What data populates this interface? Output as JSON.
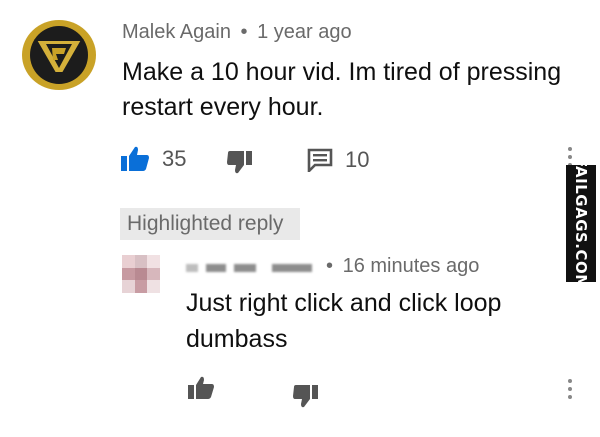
{
  "colors": {
    "accent_blue": "#0a6fd8",
    "meta_gray": "#6a6a6a",
    "icon_gray": "#555555",
    "avatar_gold": "#c9a227"
  },
  "comment": {
    "author": "Malek Again",
    "separator": "•",
    "time": "1 year ago",
    "text": "Make a 10 hour vid. Im tired of pressing restart every hour.",
    "likes": "35",
    "replies": "10",
    "icons": {
      "like": "thumbs-up-icon",
      "dislike": "thumbs-down-icon",
      "reply": "comment-icon",
      "menu": "more-vert-icon"
    }
  },
  "reply": {
    "badge": "Highlighted reply",
    "separator": "•",
    "time": "16 minutes ago",
    "text": "Just right click and click loop dumbass",
    "icons": {
      "like": "thumbs-up-icon",
      "dislike": "thumbs-down-icon",
      "menu": "more-vert-icon"
    }
  },
  "watermark": {
    "text": "FAILGAGS.COM"
  }
}
